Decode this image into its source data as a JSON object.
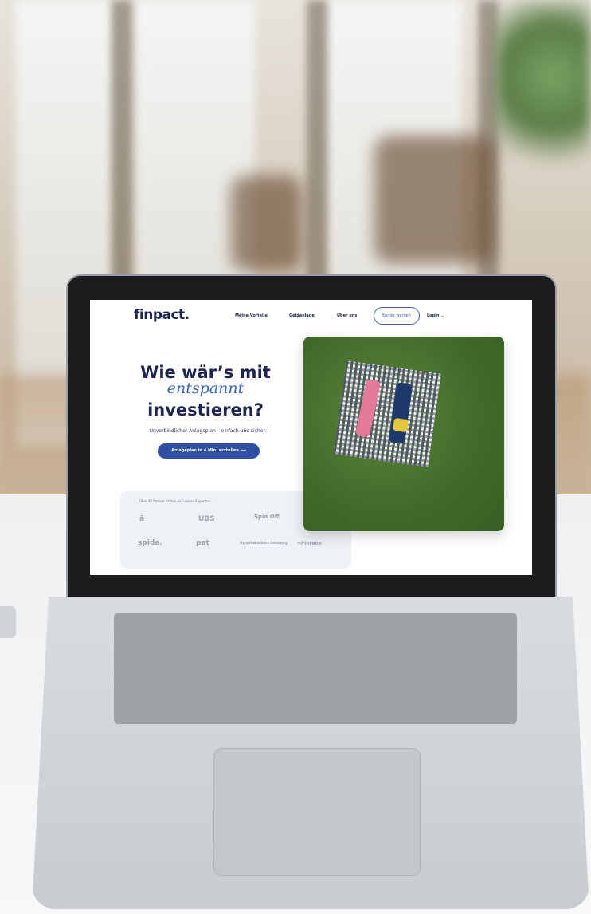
{
  "nav": {
    "logo": "finpact.",
    "links": [
      "Meine Vorteile",
      "Geldanlage",
      "Über uns"
    ],
    "cta": "Kunde werden",
    "login": "Login ⌄"
  },
  "hero": {
    "line1": "Wie wär’s mit",
    "line2": "entspannt",
    "line3": "investieren?",
    "subtitle": "Unverbindlicher Anlageplan – einfach und sicher.",
    "button": "Anlageplan in 4 Min. erstellen  ⟶"
  },
  "partners": {
    "title": "Über 40 Partner zählen auf unsere Expertise.",
    "logos": [
      "ā",
      "UBS",
      "Spin Off",
      "spida.",
      "pat",
      "Hypothekarbank Lenzburg",
      "=Finreon"
    ]
  }
}
